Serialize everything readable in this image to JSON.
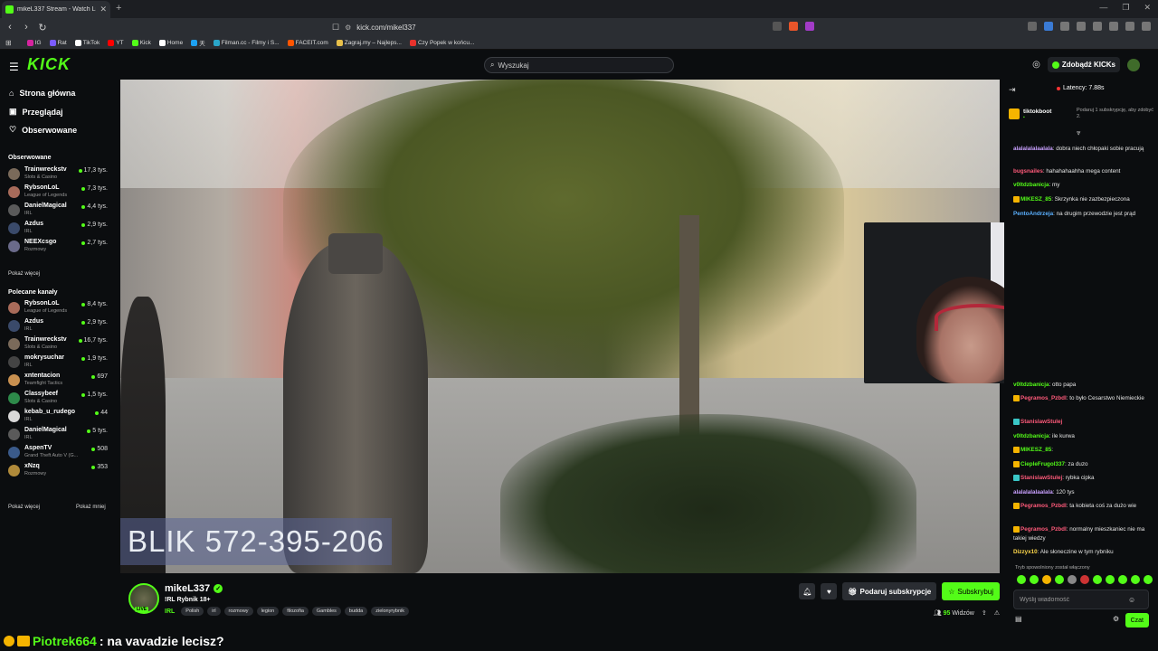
{
  "browser": {
    "tab_title": "mikeL337 Stream - Watch Li...",
    "url": "kick.com/mikel337",
    "bookmarks": [
      {
        "label": "IG",
        "color": "#d6249f"
      },
      {
        "label": "Rat",
        "color": "#7b5cff"
      },
      {
        "label": "TikTok",
        "color": "#ffffff"
      },
      {
        "label": "YT",
        "color": "#ff0000"
      },
      {
        "label": "Kick",
        "color": "#53fc18"
      },
      {
        "label": "Home",
        "color": "#ffffff"
      },
      {
        "label": "天",
        "color": "#1da1f2"
      },
      {
        "label": "Filman.cc - Filmy i S...",
        "color": "#2aa6c9"
      },
      {
        "label": "FACEIT.com",
        "color": "#ff5500"
      },
      {
        "label": "Zagraj.my – Najleps...",
        "color": "#e8c04a"
      },
      {
        "label": "Czy Popek w końcu...",
        "color": "#e8322c"
      }
    ]
  },
  "header": {
    "logo": "KICK",
    "search_placeholder": "Wyszukaj",
    "kicks_label": "Zdobądź KICKs"
  },
  "sidebar": {
    "nav": [
      {
        "label": "Strona główna",
        "icon": "home-icon"
      },
      {
        "label": "Przeglądaj",
        "icon": "browse-icon"
      },
      {
        "label": "Obserwowane",
        "icon": "heart-icon"
      }
    ],
    "followed_title": "Obserwowane",
    "followed": [
      {
        "name": "Trainwreckstv",
        "category": "Slots & Casino",
        "viewers": "17,3 tys.",
        "color": "#7a6a5a"
      },
      {
        "name": "RybsonLoL",
        "category": "League of Legends",
        "viewers": "7,3 tys.",
        "color": "#a86b5a"
      },
      {
        "name": "DanielMagical",
        "category": "IRL",
        "viewers": "4,4 tys.",
        "color": "#5a5a5a"
      },
      {
        "name": "Azdus",
        "category": "IRL",
        "viewers": "2,9 tys.",
        "color": "#3a4a6a"
      },
      {
        "name": "NEEXcsgo",
        "category": "Rozmowy",
        "viewers": "2,7 tys.",
        "color": "#6a6a8a"
      }
    ],
    "show_more": "Pokaż więcej",
    "recommended_title": "Polecane kanały",
    "recommended": [
      {
        "name": "RybsonLoL",
        "category": "League of Legends",
        "viewers": "8,4 tys.",
        "color": "#a86b5a"
      },
      {
        "name": "Azdus",
        "category": "IRL",
        "viewers": "2,9 tys.",
        "color": "#3a4a6a"
      },
      {
        "name": "Trainwreckstv",
        "category": "Slots & Casino",
        "viewers": "16,7 tys.",
        "color": "#7a6a5a"
      },
      {
        "name": "mokrysuchar",
        "category": "IRL",
        "viewers": "1,9 tys.",
        "color": "#444444"
      },
      {
        "name": "xntentacion",
        "category": "Teamfight Tactics",
        "viewers": "697",
        "color": "#c89050"
      },
      {
        "name": "Classybeef",
        "category": "Slots & Casino",
        "viewers": "1,5 tys.",
        "color": "#2d8a4a"
      },
      {
        "name": "kebab_u_rudego",
        "category": "IRL",
        "viewers": "44",
        "color": "#d8d8d8"
      },
      {
        "name": "DanielMagical",
        "category": "IRL",
        "viewers": "5 tys.",
        "color": "#5a5a5a"
      },
      {
        "name": "AspenTV",
        "category": "Grand Theft Auto V (G...",
        "viewers": "508",
        "color": "#3a5a8a"
      },
      {
        "name": "xNzq",
        "category": "Rozmowy",
        "viewers": "353",
        "color": "#b08a3a"
      }
    ],
    "show_more_2": "Pokaż więcej",
    "show_less": "Pokaż mniej"
  },
  "video": {
    "overlay_text": "BLIK 572-395-206"
  },
  "stream": {
    "username": "mikeL337",
    "live_badge": "LIVE",
    "title": "!RL Rybnik 18+",
    "category": "IRL",
    "tags": [
      "Polish",
      "irl",
      "rozmowy",
      "legion",
      "filozofia",
      "Gambles",
      "budda",
      "zielonyrybnik"
    ],
    "gift_label": "Podaruj subskrypcje",
    "subscribe_label": "Subskrybuj",
    "viewers_count": "95",
    "viewers_label": "Widzów"
  },
  "chat": {
    "latency": "Latency: 7.88s",
    "pinned_user": "tiktokboot",
    "pinned_message": "Podaruj 1 subskrypcję, aby zdobyć 2.",
    "messages_top": [
      {
        "user": "alalalalalaalala",
        "text": ": dobra niech chłopaki sobie pracują",
        "color": "#c9a0ff",
        "badge": ""
      },
      {
        "user": "bugsnailes",
        "text": ": hahahahaahha mega content",
        "color": "#ff5a7a",
        "badge": ""
      },
      {
        "user": "v0ltdzbanicja",
        "text": ": my",
        "color": "#53fc18",
        "badge": ""
      },
      {
        "user": "MIKESZ_85",
        "text": ": Skrzynka nie zazbezpieczona",
        "color": "#53fc18",
        "badge": "#f5b400"
      },
      {
        "user": "PentoAndrzeja",
        "text": ": na drugim przewodzie jest prąd",
        "color": "#5ab0ff",
        "badge": ""
      }
    ],
    "messages_bottom": [
      {
        "user": "v0ltdzbanicja",
        "text": ": otto papa",
        "color": "#53fc18",
        "badge": ""
      },
      {
        "user": "Pegramos_Pzbdl",
        "text": ": to było Cesarstwo Niemieckie",
        "color": "#ff5a7a",
        "badge": "#f5b400"
      },
      {
        "user": "StanislawStulej",
        "text": "",
        "color": "#ff5a7a",
        "badge": "#3ac7c7"
      },
      {
        "user": "v0ltdzbanicja",
        "text": ": ile kurwa",
        "color": "#53fc18",
        "badge": ""
      },
      {
        "user": "MIKESZ_85",
        "text": ":",
        "color": "#53fc18",
        "badge": "#f5b400"
      },
      {
        "user": "CiepleFrugol337",
        "text": ": za duzo",
        "color": "#53fc18",
        "badge": "#f5b400"
      },
      {
        "user": "StanislawStulej",
        "text": ": rybka cipka",
        "color": "#ff5a7a",
        "badge": "#3ac7c7"
      },
      {
        "user": "alalalalalaalala",
        "text": ": 120 tys",
        "color": "#c9a0ff",
        "badge": ""
      },
      {
        "user": "Pegramos_Pzbdl",
        "text": ": ta kobieta coś za dużo wie",
        "color": "#ff5a7a",
        "badge": "#f5b400"
      },
      {
        "user": "Pegramos_Pzbdl",
        "text": ": normalny mieszkaniec nie ma takiej wiedzy",
        "color": "#ff5a7a",
        "badge": "#f5b400"
      },
      {
        "user": "Dizzyx10",
        "text": ": Ale słoneczine w tym rybniku",
        "color": "#ffd84a",
        "badge": ""
      }
    ],
    "slow_mode": "Tryb spowolniony został włączony",
    "input_placeholder": "Wyślij wiadomość",
    "send_label": "Czat"
  },
  "bottom_overlay": {
    "user": "Piotrek664",
    "message": ": na vavadzie lecisz?"
  },
  "colors": {
    "accent": "#53fc18",
    "bg": "#0b0d0f"
  }
}
